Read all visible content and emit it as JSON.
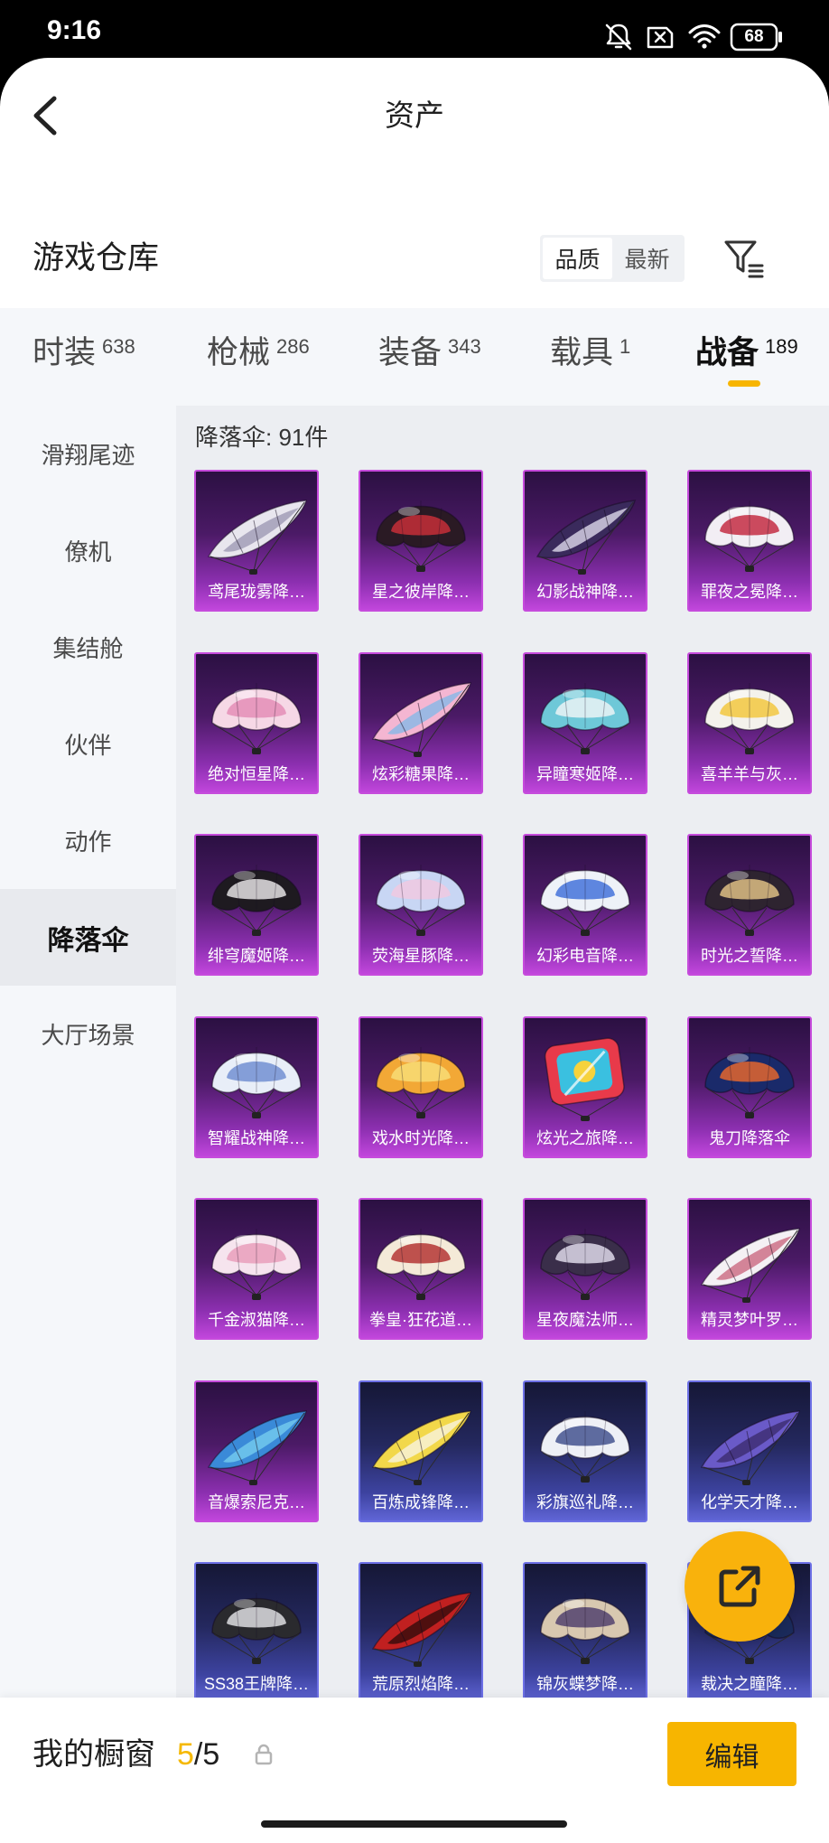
{
  "status_bar": {
    "time": "9:16",
    "battery_level": "68",
    "icons": [
      "mute-icon",
      "sim-disabled-icon",
      "wifi-icon",
      "battery-icon"
    ]
  },
  "header": {
    "title": "资产",
    "back_icon": "back-arrow-icon"
  },
  "warehouse": {
    "title": "游戏仓库",
    "sort_options": [
      {
        "label": "品质",
        "active": true
      },
      {
        "label": "最新",
        "active": false
      }
    ],
    "filter_icon": "filter-icon"
  },
  "tabs": [
    {
      "label": "时装",
      "count": "638",
      "active": false
    },
    {
      "label": "枪械",
      "count": "286",
      "active": false
    },
    {
      "label": "装备",
      "count": "343",
      "active": false
    },
    {
      "label": "载具",
      "count": "1",
      "active": false
    },
    {
      "label": "战备",
      "count": "189",
      "active": true
    }
  ],
  "sidebar": {
    "items": [
      {
        "label": "滑翔尾迹",
        "selected": false
      },
      {
        "label": "僚机",
        "selected": false
      },
      {
        "label": "集结舱",
        "selected": false
      },
      {
        "label": "伙伴",
        "selected": false
      },
      {
        "label": "动作",
        "selected": false
      },
      {
        "label": "降落伞",
        "selected": true
      },
      {
        "label": "大厅场景",
        "selected": false
      }
    ]
  },
  "content": {
    "heading": "降落伞: 91件",
    "items": [
      {
        "name": "鸢尾珑雾降…",
        "frame": "#c64bdc",
        "icon": "wing-parachute-icon",
        "colors": [
          "#e8e6ee",
          "#9a94b0"
        ]
      },
      {
        "name": "星之彼岸降…",
        "frame": "#c64bdc",
        "icon": "dome-parachute-icon",
        "colors": [
          "#2a1a24",
          "#d0303a"
        ]
      },
      {
        "name": "幻影战神降…",
        "frame": "#c64bdc",
        "icon": "wing-parachute-icon",
        "colors": [
          "#3a2a5c",
          "#e8e4f4"
        ]
      },
      {
        "name": "罪夜之冕降…",
        "frame": "#c64bdc",
        "icon": "dome-parachute-icon",
        "colors": [
          "#f2eef4",
          "#c02038"
        ]
      },
      {
        "name": "绝对恒星降…",
        "frame": "#c64bdc",
        "icon": "dome-parachute-icon",
        "colors": [
          "#f6d8e6",
          "#e48ab4"
        ]
      },
      {
        "name": "炫彩糖果降…",
        "frame": "#c64bdc",
        "icon": "wing-parachute-icon",
        "colors": [
          "#f4b6d2",
          "#7fb8e8"
        ]
      },
      {
        "name": "异瞳寒姬降…",
        "frame": "#c64bdc",
        "icon": "dome-parachute-icon",
        "colors": [
          "#6ec8d8",
          "#f2f6f8"
        ]
      },
      {
        "name": "喜羊羊与灰…",
        "frame": "#c64bdc",
        "icon": "dome-parachute-icon",
        "colors": [
          "#f4f2ec",
          "#f2c436"
        ]
      },
      {
        "name": "绯穹魔姬降…",
        "frame": "#c64bdc",
        "icon": "dome-parachute-icon",
        "colors": [
          "#1e1a20",
          "#f0eef0"
        ]
      },
      {
        "name": "荧海星豚降…",
        "frame": "#c64bdc",
        "icon": "dome-parachute-icon",
        "colors": [
          "#c8d6f4",
          "#f2c8e0"
        ]
      },
      {
        "name": "幻彩电音降…",
        "frame": "#c64bdc",
        "icon": "dome-parachute-icon",
        "colors": [
          "#eef2f8",
          "#3a6ad8"
        ]
      },
      {
        "name": "时光之誓降…",
        "frame": "#c64bdc",
        "icon": "dome-parachute-icon",
        "colors": [
          "#2e2430",
          "#e8c88a"
        ]
      },
      {
        "name": "智耀战神降…",
        "frame": "#c64bdc",
        "icon": "dome-parachute-icon",
        "colors": [
          "#e8eef8",
          "#6a8ad0"
        ]
      },
      {
        "name": "戏水时光降…",
        "frame": "#c64bdc",
        "icon": "dome-parachute-icon",
        "colors": [
          "#f2a836",
          "#f8e07a"
        ]
      },
      {
        "name": "炫光之旅降…",
        "frame": "#c64bdc",
        "icon": "square-parachute-icon",
        "colors": [
          "#e83a4a",
          "#3ac0e0"
        ]
      },
      {
        "name": "鬼刀降落伞",
        "frame": "#c64bdc",
        "icon": "dome-parachute-icon",
        "colors": [
          "#1a2a6a",
          "#f06a2a"
        ]
      },
      {
        "name": "千金淑猫降…",
        "frame": "#c64bdc",
        "icon": "dome-parachute-icon",
        "colors": [
          "#f6e4ee",
          "#e89ab8"
        ]
      },
      {
        "name": "拳皇·狂花道…",
        "frame": "#c64bdc",
        "icon": "dome-parachute-icon",
        "colors": [
          "#f4ead8",
          "#b02a2a"
        ]
      },
      {
        "name": "星夜魔法师…",
        "frame": "#c64bdc",
        "icon": "dome-parachute-icon",
        "colors": [
          "#3a2e4a",
          "#e8e4f2"
        ]
      },
      {
        "name": "精灵梦叶罗…",
        "frame": "#c64bdc",
        "icon": "wing-parachute-icon",
        "colors": [
          "#f4f0f4",
          "#c8607a"
        ]
      },
      {
        "name": "音爆索尼克…",
        "frame": "#c64bdc",
        "icon": "wing-parachute-icon",
        "colors": [
          "#3a8ad8",
          "#7ad0f0"
        ]
      },
      {
        "name": "百炼成锋降…",
        "frame": "#6d70e6",
        "icon": "wing-parachute-icon",
        "colors": [
          "#f2d84a",
          "#f8f6ea"
        ]
      },
      {
        "name": "彩旗巡礼降…",
        "frame": "#6d70e6",
        "icon": "dome-parachute-icon",
        "colors": [
          "#eef0f6",
          "#3a4a8a"
        ]
      },
      {
        "name": "化学天才降…",
        "frame": "#6d70e6",
        "icon": "wing-parachute-icon",
        "colors": [
          "#6a5ac8",
          "#3a2a6a"
        ]
      },
      {
        "name": "SS38王牌降…",
        "frame": "#6d70e6",
        "icon": "dome-parachute-icon",
        "colors": [
          "#2a2a2e",
          "#e8e8ec"
        ]
      },
      {
        "name": "荒原烈焰降…",
        "frame": "#6d70e6",
        "icon": "wing-parachute-icon",
        "colors": [
          "#c02020",
          "#2a0a0a"
        ]
      },
      {
        "name": "锦灰蝶梦降…",
        "frame": "#6d70e6",
        "icon": "dome-parachute-icon",
        "colors": [
          "#d8c8b0",
          "#4a3a6a"
        ]
      },
      {
        "name": "裁决之瞳降…",
        "frame": "#6d70e6",
        "icon": "dome-parachute-icon",
        "colors": [
          "#1a2a5a",
          "#4a7ac8"
        ]
      }
    ]
  },
  "showcase": {
    "label": "我的橱窗",
    "used": "5",
    "total_text": "/5",
    "lock_icon": "lock-icon",
    "edit_label": "编辑"
  },
  "fab": {
    "icon": "external-link-icon"
  },
  "colors": {
    "accent": "#f7b500",
    "tier_purple": "#c64bdc",
    "tier_blue": "#6d70e6"
  }
}
